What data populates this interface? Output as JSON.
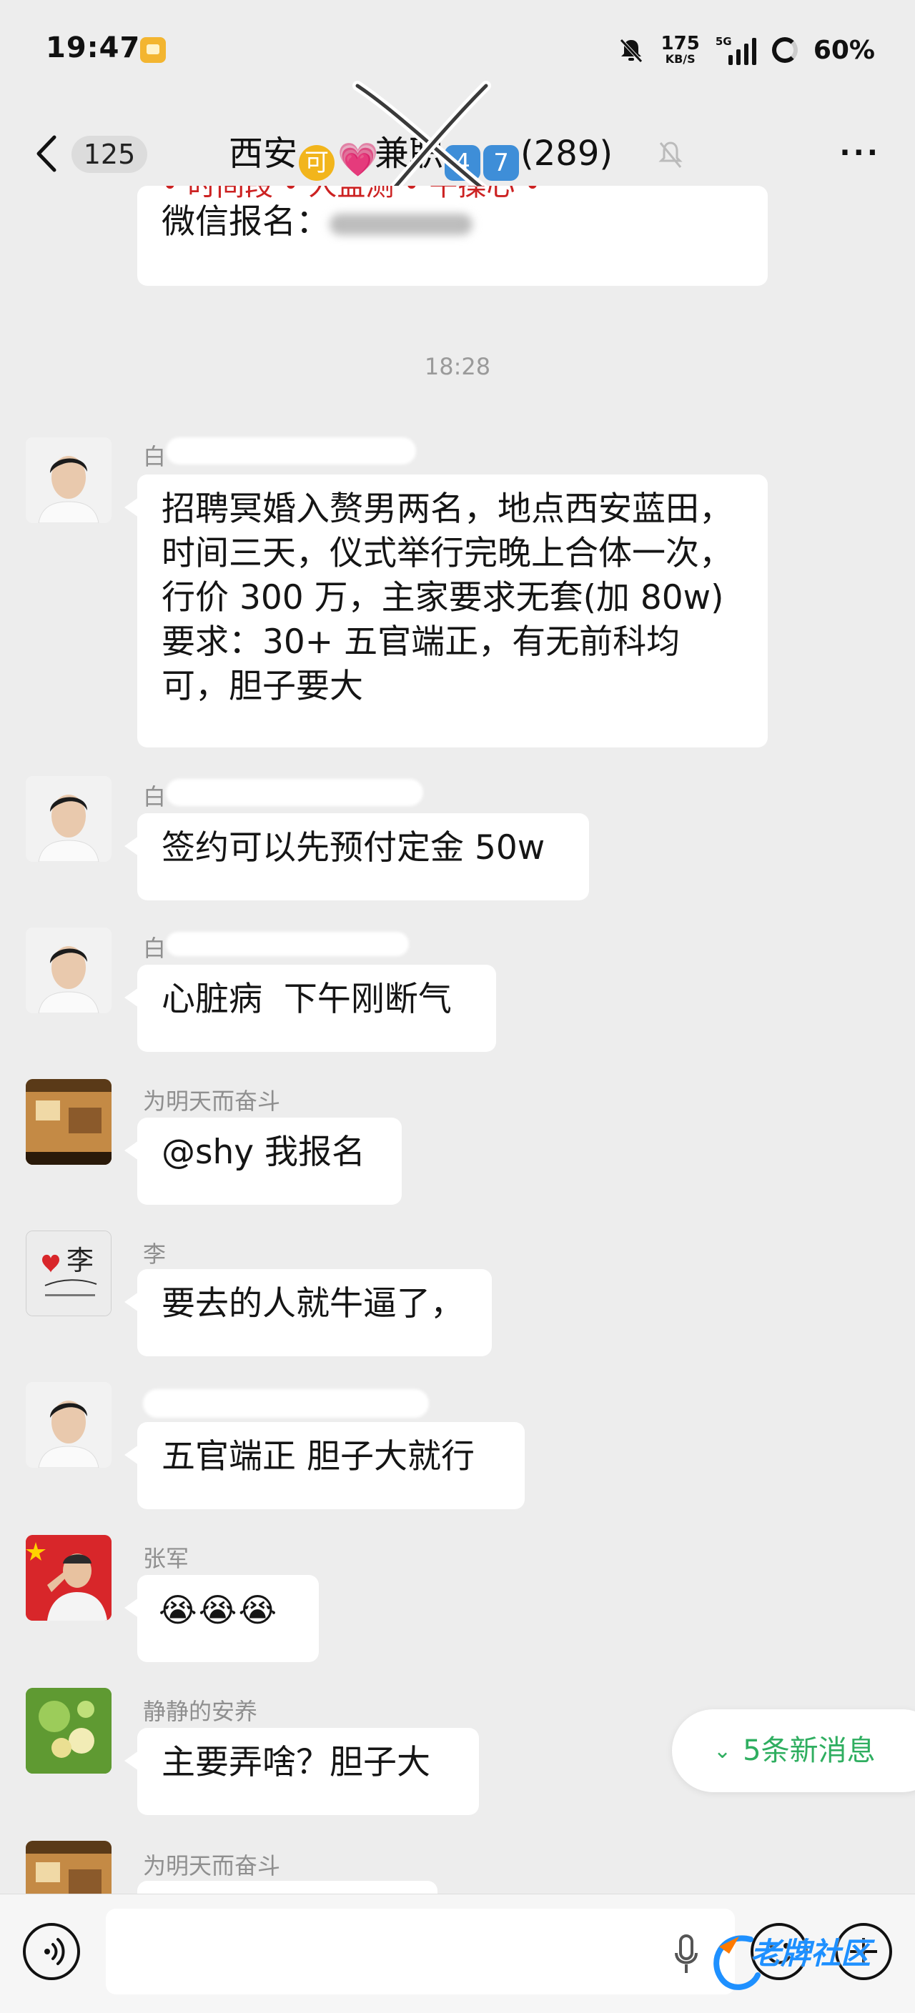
{
  "status_bar": {
    "time": "19:47",
    "net_speed_value": "175",
    "net_speed_unit": "KB/S",
    "network_type": "5G",
    "battery": "60%"
  },
  "header": {
    "back_count": "125",
    "title_prefix": "西安",
    "title_emoji_1": "可",
    "title_emoji_2": "💗",
    "title_mid": "兼职",
    "title_key_1": "4",
    "title_key_2": "7",
    "title_count": "(289)"
  },
  "messages": {
    "prev_partial_line": "• 时间段 • 人监测 • 午操心 •",
    "prev_wechat": "微信报名：",
    "timestamp": "18:28",
    "m1_text": "招聘冥婚入赘男两名，地点西安蓝田，时间三天，仪式举行完晚上合体一次，行价 300 万，主家要求无套(加 80w) 要求：30+ 五官端正，有无前科均可，胆子要大",
    "m1_sender": "白",
    "m2_text": "签约可以先预付定金 50w",
    "m2_sender": "白",
    "m3_text": "心脏病  下午刚断气",
    "m3_sender": "白",
    "m4_sender": "为明天而奋斗",
    "m4_text": "@shy 我报名",
    "m5_sender": "李",
    "m5_text": "要去的人就牛逼了，",
    "m6_text": "五官端正 胆子大就行",
    "m7_sender": "张军",
    "m7_text": "😭😭😭",
    "m8_sender": "静静的安养",
    "m8_text": "主要弄啥？胆子大",
    "m9_sender": "为明天而奋斗"
  },
  "new_messages": "5条新消息",
  "avatar_li_text": "李",
  "watermark": "老牌社区"
}
